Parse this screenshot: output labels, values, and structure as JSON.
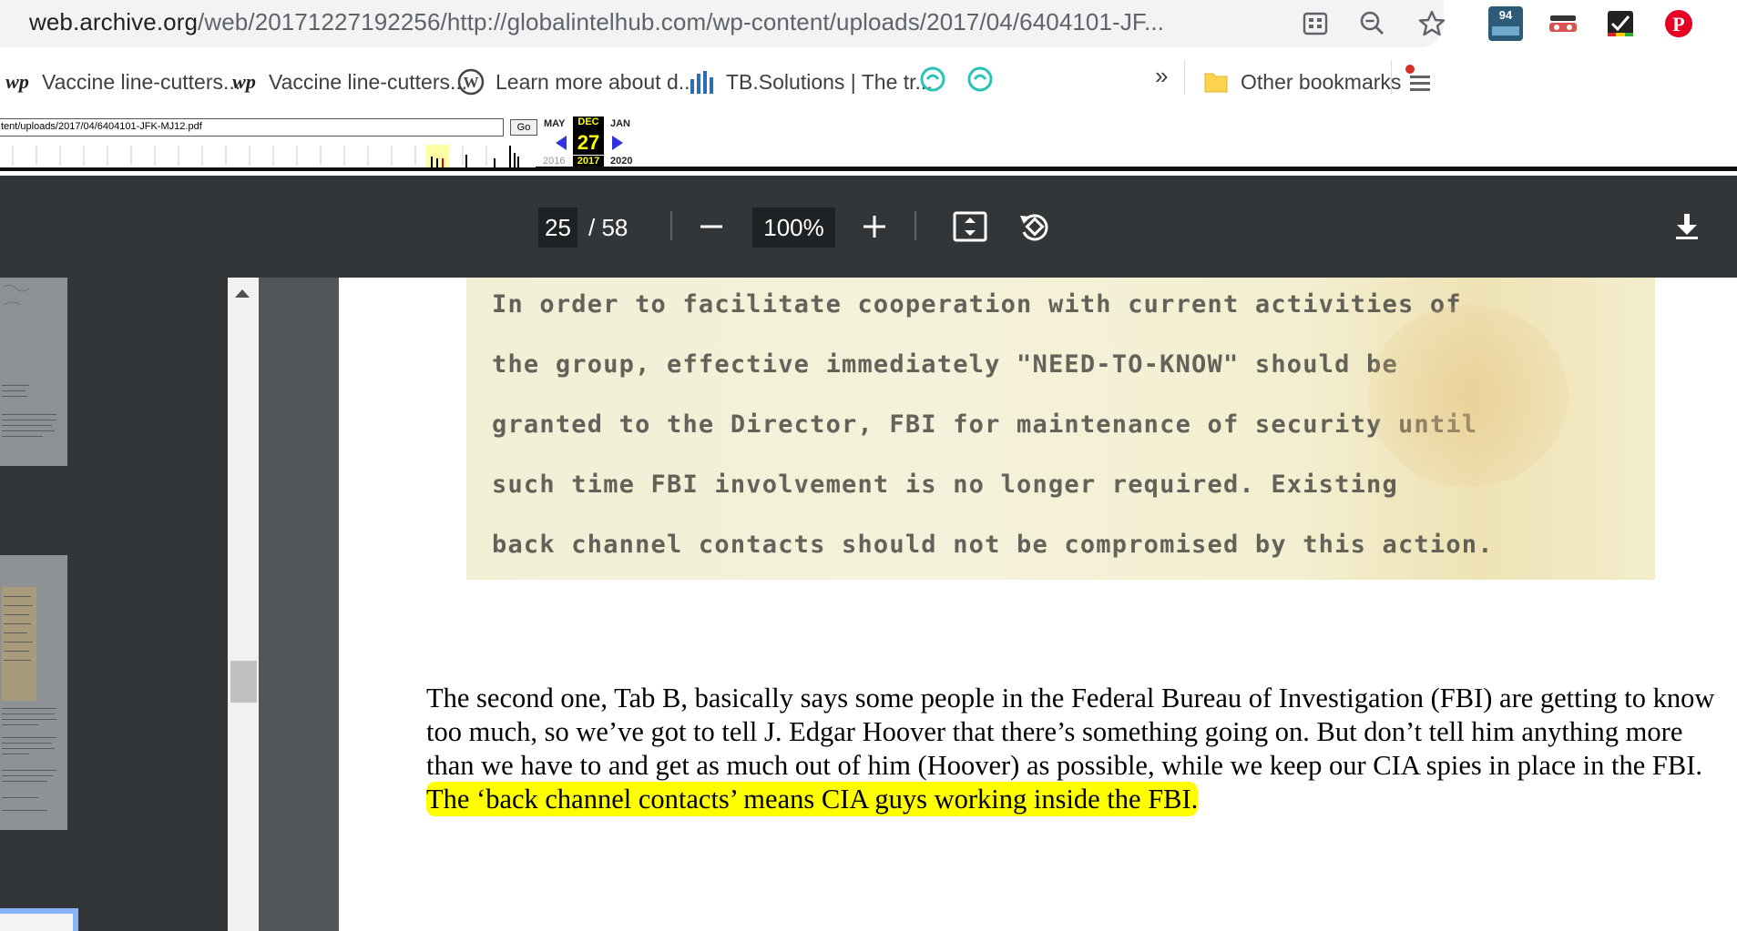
{
  "address_bar": {
    "url_domain": "web.archive.org",
    "url_rest": "/web/20171227192256/http://globalintelhub.com/wp-content/uploads/2017/04/6404101-JF...",
    "extension_badge": "94"
  },
  "bookmarks": {
    "items": [
      {
        "label": "Vaccine line-cutters..."
      },
      {
        "label": "Vaccine line-cutters..."
      },
      {
        "label": "Learn more about d..."
      },
      {
        "label": "TB.Solutions | The tr..."
      }
    ],
    "overflow": "»",
    "other": "Other bookmarks"
  },
  "wayback": {
    "url_value": "tent/uploads/2017/04/6404101-JFK-MJ12.pdf",
    "go_label": "Go",
    "months": {
      "prev": "MAY",
      "current": "DEC",
      "next": "JAN"
    },
    "day": "27",
    "years": {
      "prev": "2016",
      "current": "2017",
      "next": "2020"
    }
  },
  "pdf_toolbar": {
    "page_current": "25",
    "page_total": "/ 58",
    "zoom": "100%"
  },
  "document": {
    "scan_lines": [
      "In order to facilitate cooperation with current activities of",
      "the group, effective immediately \"NEED-TO-KNOW\" should be",
      "granted to the Director, FBI for maintenance of security until",
      "such time FBI involvement is no longer required.  Existing",
      "back channel contacts should not be compromised by this action."
    ],
    "paragraph_plain": "The second one, Tab B, basically says some people in the Federal Bureau of Investigation (FBI) are getting to know too much, so we’ve got to tell J. Edgar Hoover that there’s something going on. But don’t tell him anything more than we have to and get as much out of him (Hoover) as possible, while we keep our CIA spies in place in the FBI. ",
    "paragraph_highlight": "The ‘back channel contacts’ means CIA guys working inside the FBI."
  },
  "colors": {
    "pdf_toolbar_bg": "#323639",
    "highlight": "#fefe00",
    "wayback_day_bg": "#000000",
    "wayback_day_fg": "#ffff00"
  }
}
